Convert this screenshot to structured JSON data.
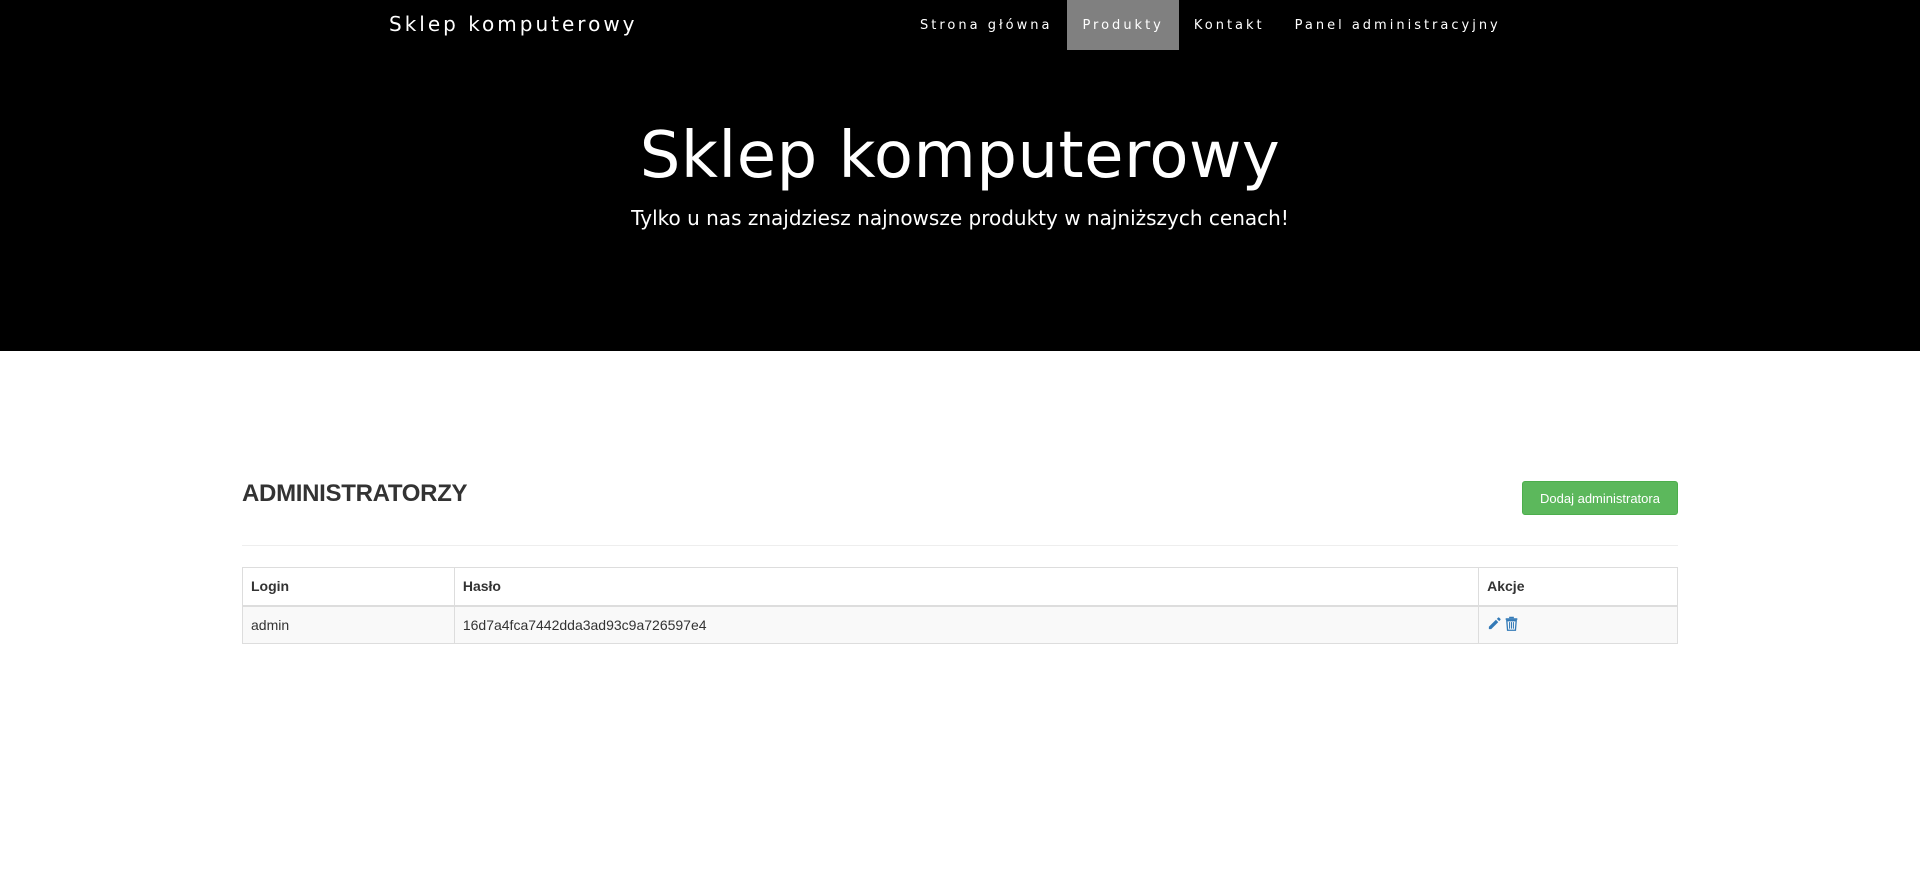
{
  "header": {
    "brand": "Sklep komputerowy",
    "nav": [
      {
        "label": "Strona główna"
      },
      {
        "label": "Produkty"
      },
      {
        "label": "Kontakt"
      },
      {
        "label": "Panel administracyjny"
      }
    ],
    "active_nav": "Produkty"
  },
  "hero": {
    "title": "Sklep komputerowy",
    "subtitle": "Tylko u nas znajdziesz najnowsze produkty w najniższych cenach!"
  },
  "main": {
    "title": "ADMINISTRATORZY",
    "add_button": "Dodaj administratora",
    "table": {
      "headers": {
        "login": "Login",
        "password": "Hasło",
        "actions": "Akcje"
      },
      "rows": [
        {
          "login": "admin",
          "password": "16d7a4fca7442dda3ad93c9a726597e4",
          "actions": [
            "pencil-icon",
            "trash-icon"
          ]
        }
      ]
    }
  },
  "colors": {
    "hero_bg": "#000000",
    "nav_active_bg": "#808080",
    "add_button_bg": "#5cb85c",
    "action_icon": "#337ab7"
  }
}
